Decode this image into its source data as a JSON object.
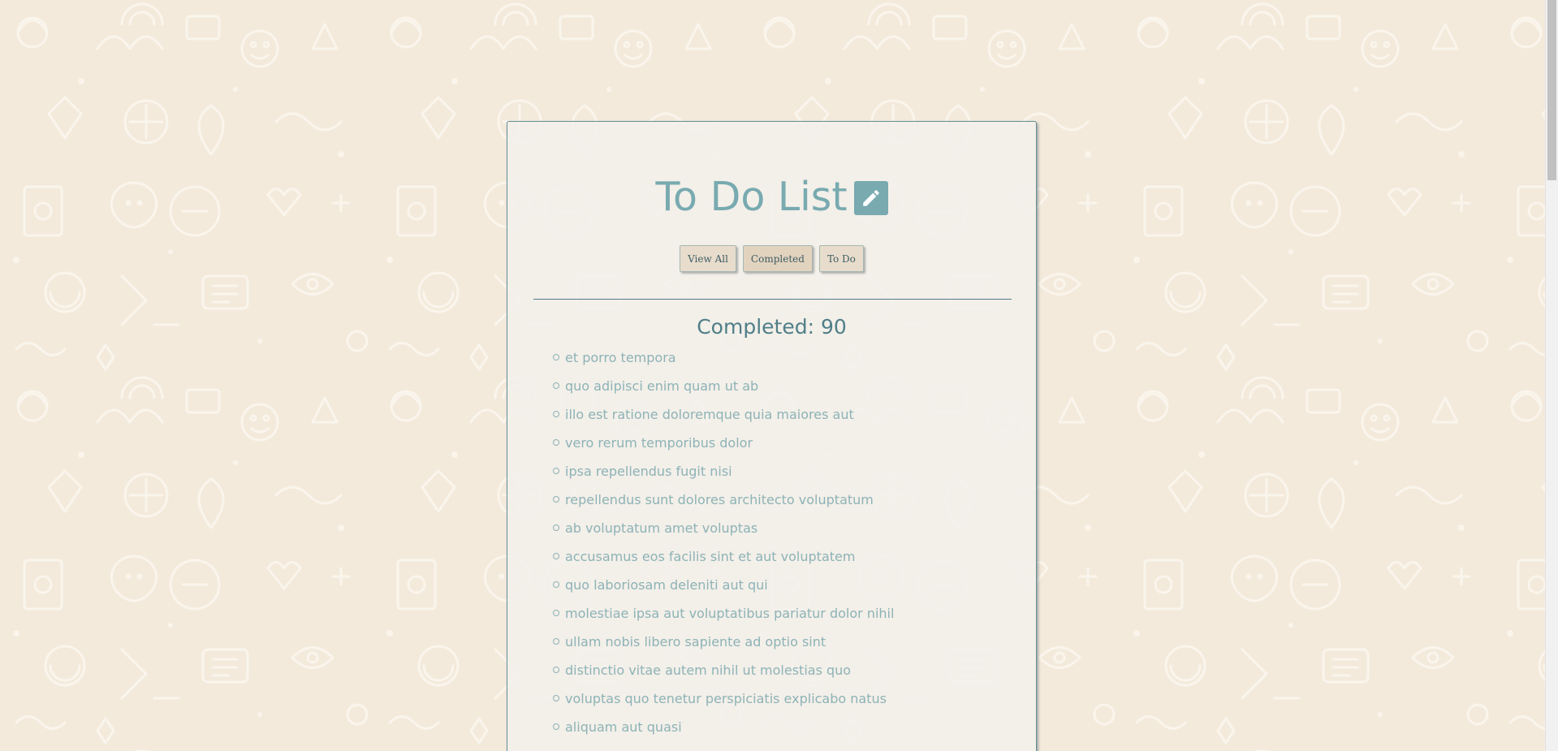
{
  "app": {
    "title": "To Do List"
  },
  "colors": {
    "page_background": "#f3eadc",
    "accent": "#78aab0",
    "heading": "#4f7f88",
    "item_text": "#8db3b6",
    "button_background": "#e8dccc"
  },
  "header": {
    "title": "To Do List",
    "edit_icon": "pencil-icon"
  },
  "filters": [
    {
      "label": "View All"
    },
    {
      "label": "Completed",
      "active": true
    },
    {
      "label": "To Do"
    }
  ],
  "section": {
    "heading": "Completed: 90"
  },
  "tasks": [
    "et porro tempora",
    "quo adipisci enim quam ut ab",
    "illo est ratione doloremque quia maiores aut",
    "vero rerum temporibus dolor",
    "ipsa repellendus fugit nisi",
    "repellendus sunt dolores architecto voluptatum",
    "ab voluptatum amet voluptas",
    "accusamus eos facilis sint et aut voluptatem",
    "quo laboriosam deleniti aut qui",
    "molestiae ipsa aut voluptatibus pariatur dolor nihil",
    "ullam nobis libero sapiente ad optio sint",
    "distinctio vitae autem nihil ut molestias quo",
    "voluptas quo tenetur perspiciatis explicabo natus",
    "aliquam aut quasi"
  ]
}
